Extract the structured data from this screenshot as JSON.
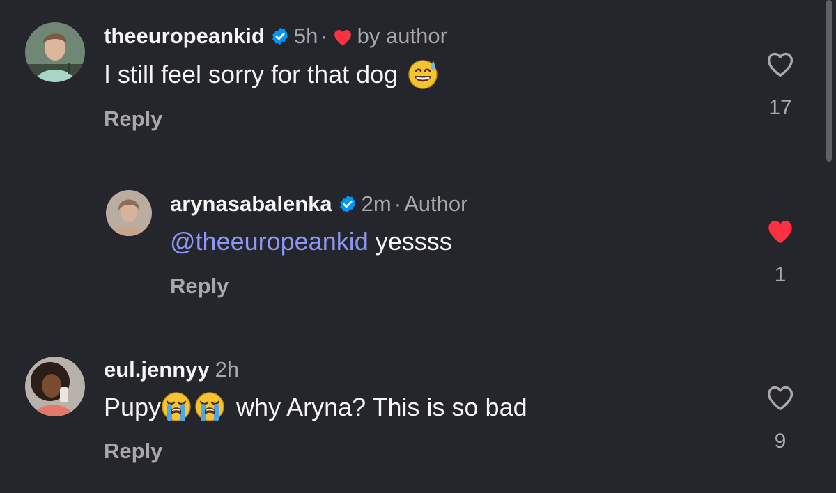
{
  "comments": [
    {
      "username": "theeuropeankid",
      "verified": true,
      "time": "5h",
      "sep": "·",
      "badge": "by author",
      "text": "I still feel sorry for that dog",
      "emoji": "grinning-sweat",
      "reply_label": "Reply",
      "likes": "17",
      "liked": false
    },
    {
      "username": "arynasabalenka",
      "verified": true,
      "time": "2m",
      "sep": "·",
      "badge": "Author",
      "mention": "@theeuropeankid",
      "text": "yessss",
      "reply_label": "Reply",
      "likes": "1",
      "liked": true
    },
    {
      "username": "eul.jennyy",
      "verified": false,
      "time": "2h",
      "text_start": "Pupy",
      "emoji": "loudly-crying",
      "text": "why Aryna? This is so bad",
      "reply_label": "Reply",
      "likes": "9",
      "liked": false
    }
  ],
  "colors": {
    "background": "#25262b",
    "muted": "#a8a8a8",
    "mention": "#8e97f6",
    "verified": "#0095f6",
    "like_red": "#ff3040"
  }
}
